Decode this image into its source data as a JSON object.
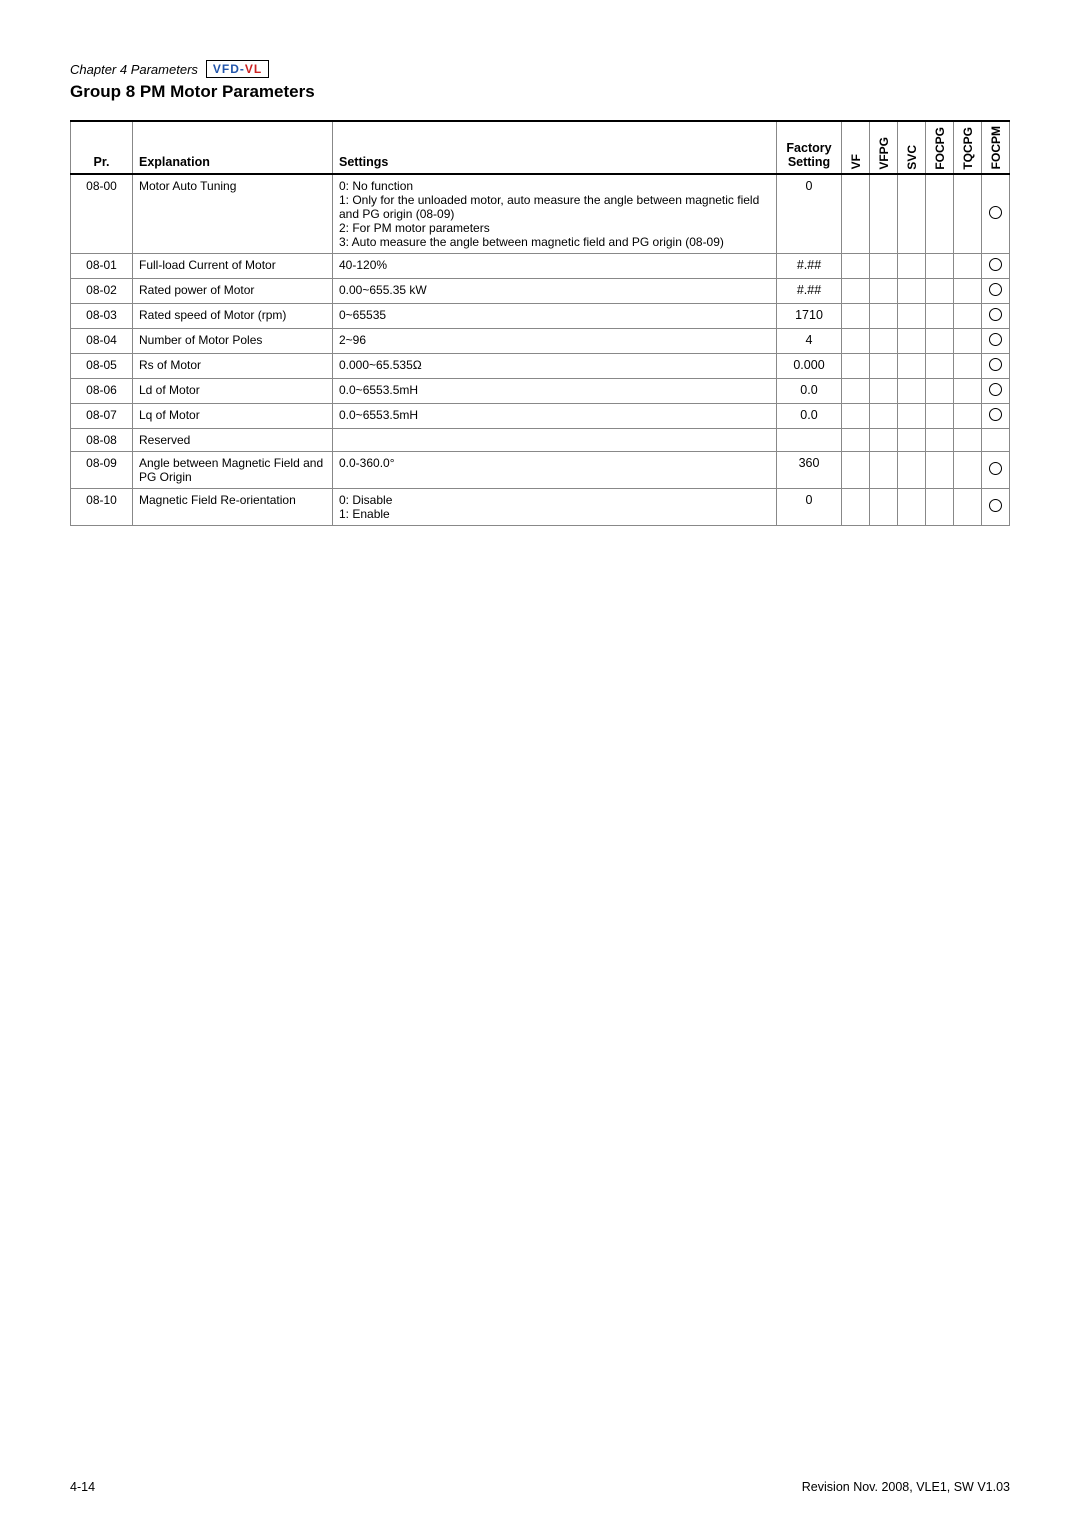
{
  "chapter": {
    "label": "Chapter 4 Parameters",
    "brand": "VFD-VL",
    "group_title": "Group 8 PM Motor Parameters"
  },
  "table": {
    "headers": {
      "pr": "Pr.",
      "explanation": "Explanation",
      "settings": "Settings",
      "factory_setting": "Factory Setting",
      "vf": "VF",
      "vfpg": "VFPG",
      "svc": "SVC",
      "focpg": "FOCPG",
      "tqcpg": "TQCPG",
      "focpm": "FOCPM"
    },
    "rows": [
      {
        "pr": "08-00",
        "explanation": "Motor Auto Tuning",
        "settings": "0: No function\n1: Only for the unloaded motor, auto measure the angle between magnetic field and PG origin (08-09)\n2: For PM motor parameters\n3: Auto measure the angle between magnetic field and PG origin (08-09)",
        "factory_setting": "0",
        "vf": "",
        "vfpg": "",
        "svc": "",
        "focpg": "",
        "tqcpg": "",
        "focpm": "circle"
      },
      {
        "pr": "08-01",
        "explanation": "Full-load Current of Motor",
        "settings": "40-120%",
        "factory_setting": "#.##",
        "vf": "",
        "vfpg": "",
        "svc": "",
        "focpg": "",
        "tqcpg": "",
        "focpm": "circle"
      },
      {
        "pr": "08-02",
        "explanation": "Rated power of Motor",
        "settings": "0.00~655.35 kW",
        "factory_setting": "#.##",
        "vf": "",
        "vfpg": "",
        "svc": "",
        "focpg": "",
        "tqcpg": "",
        "focpm": "circle"
      },
      {
        "pr": "08-03",
        "explanation": "Rated speed of Motor (rpm)",
        "settings": "0~65535",
        "factory_setting": "1710",
        "vf": "",
        "vfpg": "",
        "svc": "",
        "focpg": "",
        "tqcpg": "",
        "focpm": "circle"
      },
      {
        "pr": "08-04",
        "explanation": "Number of Motor Poles",
        "settings": "2~96",
        "factory_setting": "4",
        "vf": "",
        "vfpg": "",
        "svc": "",
        "focpg": "",
        "tqcpg": "",
        "focpm": "circle"
      },
      {
        "pr": "08-05",
        "explanation": "Rs of Motor",
        "settings": "0.000~65.535Ω",
        "factory_setting": "0.000",
        "vf": "",
        "vfpg": "",
        "svc": "",
        "focpg": "",
        "tqcpg": "",
        "focpm": "circle"
      },
      {
        "pr": "08-06",
        "explanation": "Ld of Motor",
        "settings": "0.0~6553.5mH",
        "factory_setting": "0.0",
        "vf": "",
        "vfpg": "",
        "svc": "",
        "focpg": "",
        "tqcpg": "",
        "focpm": "circle"
      },
      {
        "pr": "08-07",
        "explanation": "Lq of Motor",
        "settings": "0.0~6553.5mH",
        "factory_setting": "0.0",
        "vf": "",
        "vfpg": "",
        "svc": "",
        "focpg": "",
        "tqcpg": "",
        "focpm": "circle"
      },
      {
        "pr": "08-08",
        "explanation": "Reserved",
        "settings": "",
        "factory_setting": "",
        "vf": "",
        "vfpg": "",
        "svc": "",
        "focpg": "",
        "tqcpg": "",
        "focpm": ""
      },
      {
        "pr": "08-09",
        "explanation": "Angle between Magnetic Field and PG Origin",
        "settings": "0.0-360.0°",
        "factory_setting": "360",
        "vf": "",
        "vfpg": "",
        "svc": "",
        "focpg": "",
        "tqcpg": "",
        "focpm": "circle"
      },
      {
        "pr": "08-10",
        "explanation": "Magnetic Field Re-orientation",
        "settings": "0: Disable\n1: Enable",
        "factory_setting": "0",
        "vf": "",
        "vfpg": "",
        "svc": "",
        "focpg": "",
        "tqcpg": "",
        "focpm": "circle"
      }
    ]
  },
  "footer": {
    "page_number": "4-14",
    "revision": "Revision Nov. 2008, VLE1, SW V1.03"
  }
}
